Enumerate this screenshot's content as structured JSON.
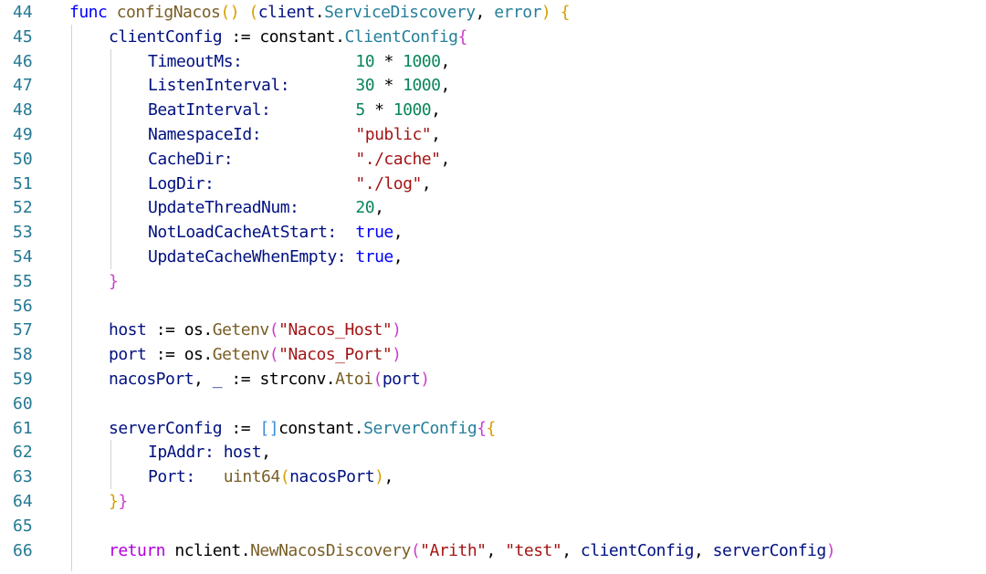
{
  "lines": [
    {
      "n": "44",
      "indent": 0,
      "tokens": [
        {
          "t": "func ",
          "c": "kw"
        },
        {
          "t": "configNacos",
          "c": "fn"
        },
        {
          "t": "() ",
          "c": "b1"
        },
        {
          "t": "(",
          "c": "b1"
        },
        {
          "t": "client",
          "c": "var"
        },
        {
          "t": ".",
          "c": "plain"
        },
        {
          "t": "ServiceDiscovery",
          "c": "type"
        },
        {
          "t": ", ",
          "c": "plain"
        },
        {
          "t": "error",
          "c": "type"
        },
        {
          "t": ") ",
          "c": "b1"
        },
        {
          "t": "{",
          "c": "b1"
        }
      ]
    },
    {
      "n": "45",
      "indent": 1,
      "tokens": [
        {
          "t": "clientConfig",
          "c": "var"
        },
        {
          "t": " := ",
          "c": "plain"
        },
        {
          "t": "constant",
          "c": "plain"
        },
        {
          "t": ".",
          "c": "plain"
        },
        {
          "t": "ClientConfig",
          "c": "type"
        },
        {
          "t": "{",
          "c": "b2"
        }
      ]
    },
    {
      "n": "46",
      "indent": 2,
      "tokens": [
        {
          "t": "TimeoutMs:            ",
          "c": "var"
        },
        {
          "t": "10",
          "c": "num"
        },
        {
          "t": " * ",
          "c": "plain"
        },
        {
          "t": "1000",
          "c": "num"
        },
        {
          "t": ",",
          "c": "plain"
        }
      ]
    },
    {
      "n": "47",
      "indent": 2,
      "tokens": [
        {
          "t": "ListenInterval:       ",
          "c": "var"
        },
        {
          "t": "30",
          "c": "num"
        },
        {
          "t": " * ",
          "c": "plain"
        },
        {
          "t": "1000",
          "c": "num"
        },
        {
          "t": ",",
          "c": "plain"
        }
      ]
    },
    {
      "n": "48",
      "indent": 2,
      "tokens": [
        {
          "t": "BeatInterval:         ",
          "c": "var"
        },
        {
          "t": "5",
          "c": "num"
        },
        {
          "t": " * ",
          "c": "plain"
        },
        {
          "t": "1000",
          "c": "num"
        },
        {
          "t": ",",
          "c": "plain"
        }
      ]
    },
    {
      "n": "49",
      "indent": 2,
      "tokens": [
        {
          "t": "NamespaceId:          ",
          "c": "var"
        },
        {
          "t": "\"public\"",
          "c": "str"
        },
        {
          "t": ",",
          "c": "plain"
        }
      ]
    },
    {
      "n": "50",
      "indent": 2,
      "tokens": [
        {
          "t": "CacheDir:             ",
          "c": "var"
        },
        {
          "t": "\"./cache\"",
          "c": "str"
        },
        {
          "t": ",",
          "c": "plain"
        }
      ]
    },
    {
      "n": "51",
      "indent": 2,
      "tokens": [
        {
          "t": "LogDir:               ",
          "c": "var"
        },
        {
          "t": "\"./log\"",
          "c": "str"
        },
        {
          "t": ",",
          "c": "plain"
        }
      ]
    },
    {
      "n": "52",
      "indent": 2,
      "tokens": [
        {
          "t": "UpdateThreadNum:      ",
          "c": "var"
        },
        {
          "t": "20",
          "c": "num"
        },
        {
          "t": ",",
          "c": "plain"
        }
      ]
    },
    {
      "n": "53",
      "indent": 2,
      "tokens": [
        {
          "t": "NotLoadCacheAtStart:  ",
          "c": "var"
        },
        {
          "t": "true",
          "c": "kw"
        },
        {
          "t": ",",
          "c": "plain"
        }
      ]
    },
    {
      "n": "54",
      "indent": 2,
      "tokens": [
        {
          "t": "UpdateCacheWhenEmpty: ",
          "c": "var"
        },
        {
          "t": "true",
          "c": "kw"
        },
        {
          "t": ",",
          "c": "plain"
        }
      ]
    },
    {
      "n": "55",
      "indent": 1,
      "tokens": [
        {
          "t": "}",
          "c": "b2"
        }
      ]
    },
    {
      "n": "56",
      "indent": 0,
      "tokens": []
    },
    {
      "n": "57",
      "indent": 1,
      "tokens": [
        {
          "t": "host",
          "c": "var"
        },
        {
          "t": " := ",
          "c": "plain"
        },
        {
          "t": "os",
          "c": "plain"
        },
        {
          "t": ".",
          "c": "plain"
        },
        {
          "t": "Getenv",
          "c": "fn"
        },
        {
          "t": "(",
          "c": "b2"
        },
        {
          "t": "\"Nacos_Host\"",
          "c": "str"
        },
        {
          "t": ")",
          "c": "b2"
        }
      ]
    },
    {
      "n": "58",
      "indent": 1,
      "tokens": [
        {
          "t": "port",
          "c": "var"
        },
        {
          "t": " := ",
          "c": "plain"
        },
        {
          "t": "os",
          "c": "plain"
        },
        {
          "t": ".",
          "c": "plain"
        },
        {
          "t": "Getenv",
          "c": "fn"
        },
        {
          "t": "(",
          "c": "b2"
        },
        {
          "t": "\"Nacos_Port\"",
          "c": "str"
        },
        {
          "t": ")",
          "c": "b2"
        }
      ]
    },
    {
      "n": "59",
      "indent": 1,
      "tokens": [
        {
          "t": "nacosPort",
          "c": "var"
        },
        {
          "t": ", ",
          "c": "plain"
        },
        {
          "t": "_",
          "c": "var"
        },
        {
          "t": " := ",
          "c": "plain"
        },
        {
          "t": "strconv",
          "c": "plain"
        },
        {
          "t": ".",
          "c": "plain"
        },
        {
          "t": "Atoi",
          "c": "fn"
        },
        {
          "t": "(",
          "c": "b2"
        },
        {
          "t": "port",
          "c": "var"
        },
        {
          "t": ")",
          "c": "b2"
        }
      ]
    },
    {
      "n": "60",
      "indent": 0,
      "tokens": []
    },
    {
      "n": "61",
      "indent": 1,
      "tokens": [
        {
          "t": "serverConfig",
          "c": "var"
        },
        {
          "t": " := ",
          "c": "plain"
        },
        {
          "t": "[]",
          "c": "b3"
        },
        {
          "t": "constant",
          "c": "plain"
        },
        {
          "t": ".",
          "c": "plain"
        },
        {
          "t": "ServerConfig",
          "c": "type"
        },
        {
          "t": "{",
          "c": "b2"
        },
        {
          "t": "{",
          "c": "b1"
        }
      ]
    },
    {
      "n": "62",
      "indent": 2,
      "tokens": [
        {
          "t": "IpAddr:",
          "c": "var"
        },
        {
          "t": " ",
          "c": "plain"
        },
        {
          "t": "host",
          "c": "var"
        },
        {
          "t": ",",
          "c": "plain"
        }
      ]
    },
    {
      "n": "63",
      "indent": 2,
      "tokens": [
        {
          "t": "Port:   ",
          "c": "var"
        },
        {
          "t": "uint64",
          "c": "fn"
        },
        {
          "t": "(",
          "c": "b1"
        },
        {
          "t": "nacosPort",
          "c": "var"
        },
        {
          "t": ")",
          "c": "b1"
        },
        {
          "t": ",",
          "c": "plain"
        }
      ]
    },
    {
      "n": "64",
      "indent": 1,
      "tokens": [
        {
          "t": "}",
          "c": "b1"
        },
        {
          "t": "}",
          "c": "b2"
        }
      ]
    },
    {
      "n": "65",
      "indent": 0,
      "tokens": []
    },
    {
      "n": "66",
      "indent": 1,
      "tokens": [
        {
          "t": "return",
          "c": "ret"
        },
        {
          "t": " ",
          "c": "plain"
        },
        {
          "t": "nclient",
          "c": "plain"
        },
        {
          "t": ".",
          "c": "plain"
        },
        {
          "t": "NewNacosDiscovery",
          "c": "fn"
        },
        {
          "t": "(",
          "c": "b2"
        },
        {
          "t": "\"Arith\"",
          "c": "str"
        },
        {
          "t": ", ",
          "c": "plain"
        },
        {
          "t": "\"test\"",
          "c": "str"
        },
        {
          "t": ", ",
          "c": "plain"
        },
        {
          "t": "clientConfig",
          "c": "var"
        },
        {
          "t": ", ",
          "c": "plain"
        },
        {
          "t": "serverConfig",
          "c": "var"
        },
        {
          "t": ")",
          "c": "b2"
        }
      ]
    }
  ]
}
